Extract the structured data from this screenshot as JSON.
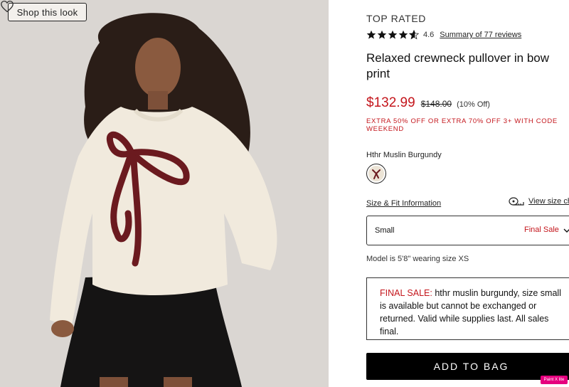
{
  "product_image": {
    "shop_label": "Shop this look",
    "wishlist_icon": "heart-outline-icon"
  },
  "product": {
    "badge": "TOP RATED",
    "rating_value": "4.6",
    "rating_stars": 4.6,
    "reviews_link": "Summary of 77 reviews",
    "title": "Relaxed crewneck pullover in bow print",
    "sale_price": "$132.99",
    "original_price": "$148.00",
    "discount": "(10% Off)",
    "promo": "EXTRA 50% OFF OR EXTRA 70% OFF 3+ WITH CODE WEEKEND",
    "color_name": "Hthr Muslin Burgundy"
  },
  "sizing": {
    "size_fit_link": "Size & Fit Information",
    "size_chart_link": "View size ch",
    "selected_size": "Small",
    "size_status": "Final Sale",
    "model_note": "Model is 5'8\" wearing size XS"
  },
  "final_sale": {
    "label": "FINAL SALE:",
    "text": " hthr muslin burgundy, size small is available but cannot be exchanged or returned. Valid while supplies last. All sales final."
  },
  "actions": {
    "add_to_bag": "ADD TO BAG"
  },
  "overlay": {
    "badge": "Paint X lite"
  },
  "colors": {
    "sale_red": "#c4161c",
    "button_black": "#000000",
    "sweater_cream": "#f1eadd",
    "bow_burgundy": "#6b1a1f"
  }
}
